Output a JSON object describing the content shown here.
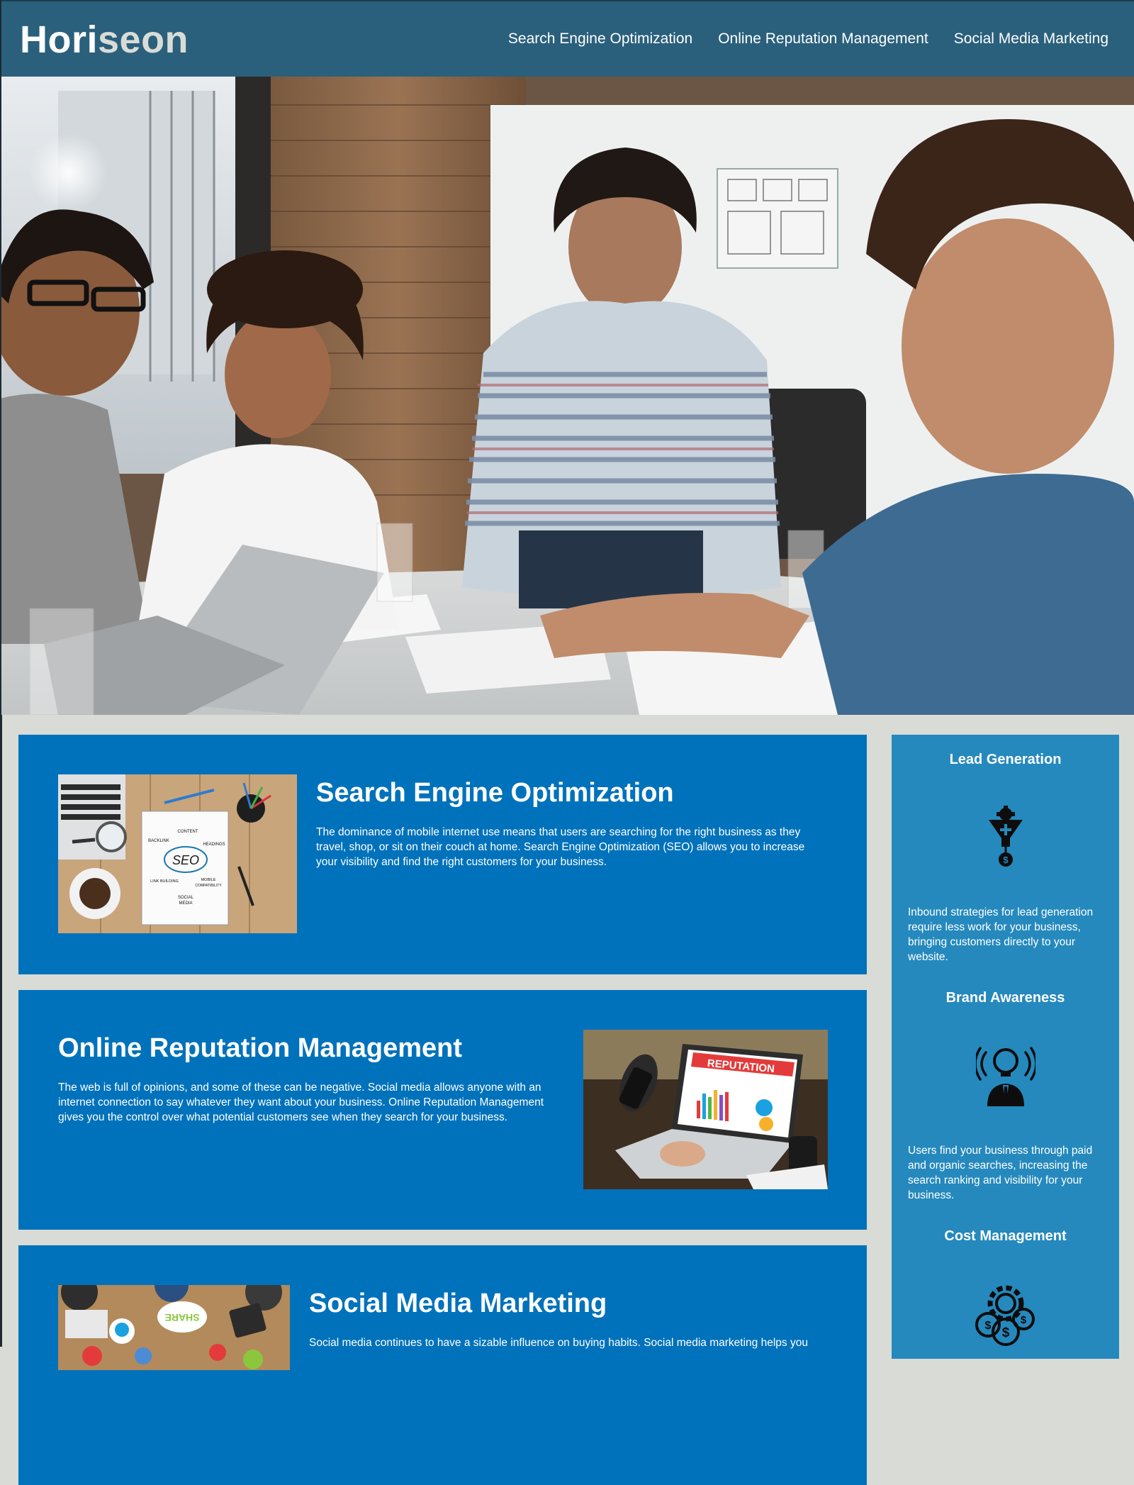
{
  "header": {
    "logo_main": "Hori",
    "logo_accent": "seon",
    "nav": [
      {
        "label": "Search Engine Optimization"
      },
      {
        "label": "Online Reputation Management"
      },
      {
        "label": "Social Media Marketing"
      }
    ]
  },
  "content": [
    {
      "title": "Search Engine Optimization",
      "text": "The dominance of mobile internet use means that users are searching for the right business as they travel, shop, or sit on their couch at home. Search Engine Optimization (SEO) allows you to increase your visibility and find the right customers for your business.",
      "image_labels": {
        "seo": "SEO",
        "content": "CONTENT",
        "backlink": "BACKLINK",
        "headings": "HEADINGS",
        "link_building": "LINK BUILDING",
        "mobile": "MOBILE",
        "compatibility": "COMPATIBILITY",
        "social": "SOCIAL",
        "media": "MEDIA"
      }
    },
    {
      "title": "Online Reputation Management",
      "text": "The web is full of opinions, and some of these can be negative. Social media allows anyone with an internet connection to say whatever they want about your business. Online Reputation Management gives you the control over what potential customers see when they search for your business.",
      "image_labels": {
        "banner": "REPUTATION"
      }
    },
    {
      "title": "Social Media Marketing",
      "text": "Social media continues to have a sizable influence on buying habits. Social media marketing helps you",
      "image_labels": {
        "share": "SHARE"
      }
    }
  ],
  "aside": [
    {
      "title": "Lead Generation",
      "icon": "lead-generation-funnel-icon",
      "text": "Inbound strategies for lead generation require less work for your business, bringing customers directly to your website."
    },
    {
      "title": "Brand Awareness",
      "icon": "brand-awareness-lightbulb-icon",
      "text": "Users find your business through paid and organic searches, increasing the search ranking and visibility for your business."
    },
    {
      "title": "Cost Management",
      "icon": "cost-management-gear-coins-icon",
      "text": ""
    }
  ],
  "colors": {
    "header_bg": "#2a607c",
    "page_bg": "#d9dcd6",
    "card_bg": "#0072bb",
    "aside_bg": "#2589bd"
  }
}
